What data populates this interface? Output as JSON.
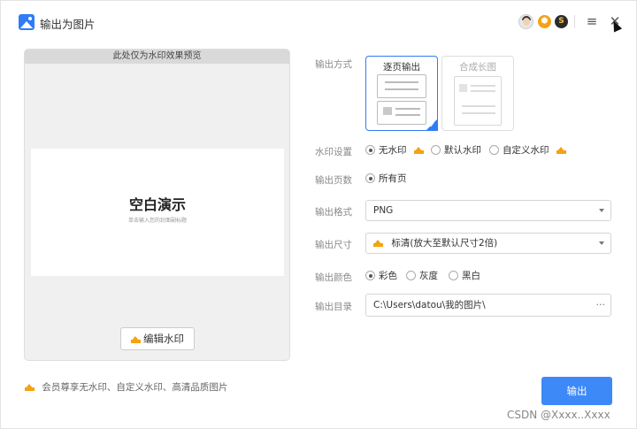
{
  "window": {
    "title": "输出为图片",
    "menu_icon": "≡",
    "close_icon": "✕"
  },
  "preview": {
    "header": "此处仅为水印效果预览",
    "slide_title": "空白演示",
    "slide_subtitle": "单击输入您的封面副标题",
    "edit_watermark_label": "编辑水印"
  },
  "vip_note": "会员尊享无水印、自定义水印、高清品质图片",
  "form": {
    "mode": {
      "label": "输出方式",
      "options": [
        "逐页输出",
        "合成长图"
      ],
      "selected": "逐页输出"
    },
    "watermark": {
      "label": "水印设置",
      "options": [
        "无水印",
        "默认水印",
        "自定义水印"
      ],
      "selected": "无水印"
    },
    "pages": {
      "label": "输出页数",
      "options": [
        "所有页"
      ],
      "selected": "所有页"
    },
    "format": {
      "label": "输出格式",
      "value": "PNG"
    },
    "size": {
      "label": "输出尺寸",
      "value": "标清(放大至默认尺寸2倍)"
    },
    "color": {
      "label": "输出颜色",
      "options": [
        "彩色",
        "灰度",
        "黑白"
      ],
      "selected": "彩色"
    },
    "directory": {
      "label": "输出目录",
      "value": "C:\\Users\\datou\\我的图片\\",
      "more": "···"
    }
  },
  "export_button": "输出",
  "watermark_text": "CSDN @Xxxx..Xxxx",
  "colors": {
    "accent": "#3d89f7",
    "vip": "#f5a213"
  }
}
